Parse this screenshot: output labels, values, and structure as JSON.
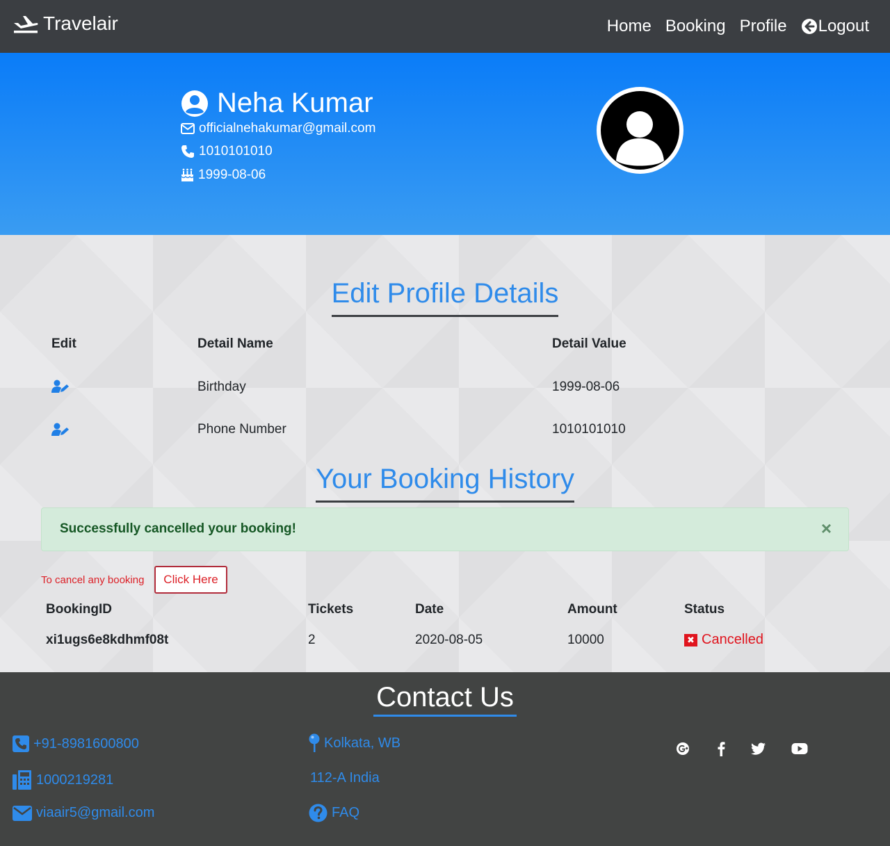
{
  "navbar": {
    "brand": "Travelair",
    "links": [
      {
        "label": "Home"
      },
      {
        "label": "Booking"
      },
      {
        "label": "Profile"
      },
      {
        "label": "Logout",
        "icon": "arrow-left-circle-icon"
      }
    ]
  },
  "profile": {
    "name": "Neha Kumar",
    "email": "officialnehakumar@gmail.com",
    "phone": "1010101010",
    "birthday": "1999-08-06"
  },
  "edit_section": {
    "title": "Edit Profile Details",
    "headers": [
      "Edit",
      "Detail Name",
      "Detail Value"
    ],
    "rows": [
      {
        "name": "Birthday",
        "value": "1999-08-06"
      },
      {
        "name": "Phone Number",
        "value": "1010101010"
      }
    ]
  },
  "booking_section": {
    "title": "Your Booking History",
    "alert": "Successfully cancelled your booking!",
    "alert_close": "×",
    "cancel_note": "To cancel any booking",
    "cancel_button": "Click Here",
    "headers": [
      "BookingID",
      "Tickets",
      "Date",
      "Amount",
      "Status"
    ],
    "rows": [
      {
        "id": "xi1ugs6e8kdhmf08t",
        "tickets": "2",
        "date": "2020-08-05",
        "amount": "10000",
        "status": "Cancelled",
        "status_mark": "✖"
      }
    ]
  },
  "footer": {
    "title": "Contact Us",
    "phone": "+91-8981600800",
    "fax": "1000219281",
    "email": "viaair5@gmail.com",
    "location": "Kolkata, WB",
    "address": "112-A India",
    "faq": "FAQ",
    "socials": [
      "google-plus-icon",
      "facebook-icon",
      "twitter-icon",
      "youtube-icon"
    ]
  },
  "colors": {
    "navbar_bg": "#3b3e42",
    "hero_top": "#0a7cf8",
    "hero_bottom": "#3a9cf2",
    "accent_blue": "#2f8bea",
    "danger": "#e0141e",
    "success_bg": "#d4ebdb",
    "footer_bg": "#424443"
  }
}
